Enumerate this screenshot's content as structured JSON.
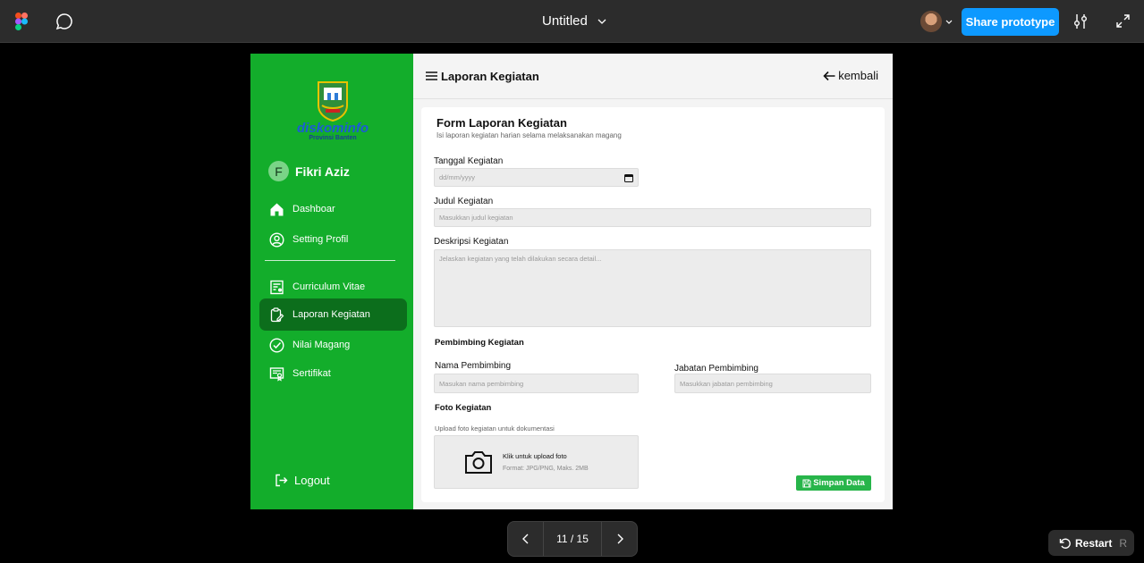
{
  "figma": {
    "title": "Untitled",
    "share_label": "Share prototype",
    "pager": "11 / 15",
    "restart_label": "Restart",
    "restart_key": "R"
  },
  "app": {
    "brand": {
      "logo_text": "diskominfo",
      "logo_sub": "Provinsi Banten"
    },
    "user": {
      "initial": "F",
      "name": "Fikri Aziz"
    },
    "nav": [
      {
        "label": "Dashboar",
        "icon": "home-icon"
      },
      {
        "label": "Setting Profil",
        "icon": "user-circle-icon"
      },
      {
        "label": "Curriculum Vitae",
        "icon": "cv-document-icon"
      },
      {
        "label": "Laporan Kegiatan",
        "icon": "clipboard-edit-icon",
        "active": true
      },
      {
        "label": "Nilai Magang",
        "icon": "check-circle-icon"
      },
      {
        "label": "Sertifikat",
        "icon": "certificate-icon"
      }
    ],
    "logout_label": "Logout",
    "header": {
      "title": "Laporan Kegiatan",
      "back_label": "kembali"
    },
    "form": {
      "title": "Form Laporan Kegiatan",
      "subtitle": "Isi laporan kegiatan harian selama melaksanakan magang",
      "date_label": "Tanggal Kegiatan",
      "date_placeholder": "dd/mm/yyyy",
      "judul_label": "Judul Kegiatan",
      "judul_placeholder": "Masukkan judul kegiatan",
      "deskripsi_label": "Deskripsi Kegiatan",
      "deskripsi_placeholder": "Jelaskan kegiatan yang telah dilakukan secara detail...",
      "pembimbing_section": "Pembimbing Kegiatan",
      "nama_label": "Nama Pembimbing",
      "nama_placeholder": "Masukan nama pembimbing",
      "jabatan_label": "Jabatan Pembimbing",
      "jabatan_placeholder": "Masukkan jabatan pembimbing",
      "foto_section": "Foto Kegiatan",
      "foto_note": "Upload foto kegiatan untuk dokumentasi",
      "upload_main": "Klik untuk upload foto",
      "upload_hint": "Format: JPG/PNG, Maks. 2MB",
      "save_label": "Simpan Data"
    },
    "colors": {
      "sidebar": "#13ad2b",
      "active": "#0c6e1c",
      "save": "#27b54a",
      "share": "#0d99ff"
    }
  }
}
